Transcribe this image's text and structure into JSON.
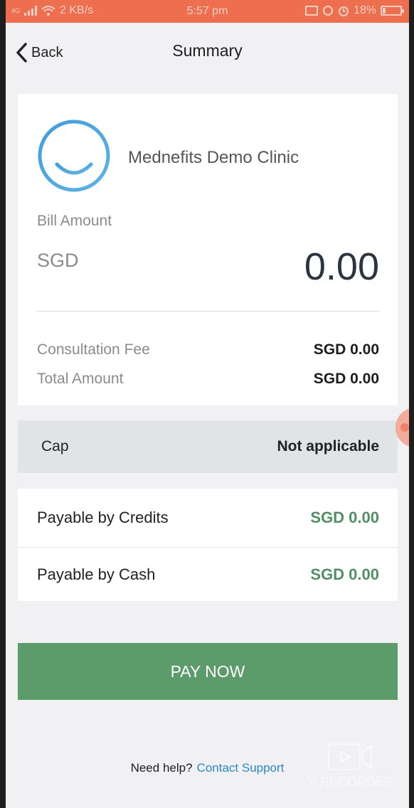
{
  "status_bar": {
    "signal_text": "4G",
    "data_speed": "2 KB/s",
    "time": "5:57 pm",
    "battery": "18%",
    "bg_color": "#ee6e50"
  },
  "nav": {
    "back_label": "Back",
    "title": "Summary"
  },
  "clinic": {
    "name": "Mednefits Demo Clinic",
    "logo_icon": "smile-logo-icon"
  },
  "bill": {
    "label": "Bill Amount",
    "currency": "SGD",
    "amount": "0.00"
  },
  "breakdown": [
    {
      "label": "Consultation Fee",
      "value": "SGD 0.00"
    },
    {
      "label": "Total Amount",
      "value": "SGD 0.00"
    }
  ],
  "cap": {
    "label": "Cap",
    "value": "Not applicable"
  },
  "payable": [
    {
      "label": "Payable by Credits",
      "value": "SGD 0.00"
    },
    {
      "label": "Payable by Cash",
      "value": "SGD 0.00"
    }
  ],
  "pay_button": "PAY NOW",
  "help": {
    "text": "Need help?",
    "link": "Contact Support"
  },
  "watermark": "V RECORDER",
  "colors": {
    "accent_green": "#5c9b6a",
    "value_green": "#4f9162",
    "link_blue": "#2a88c7",
    "logo_blue": "#3a9ad9"
  }
}
